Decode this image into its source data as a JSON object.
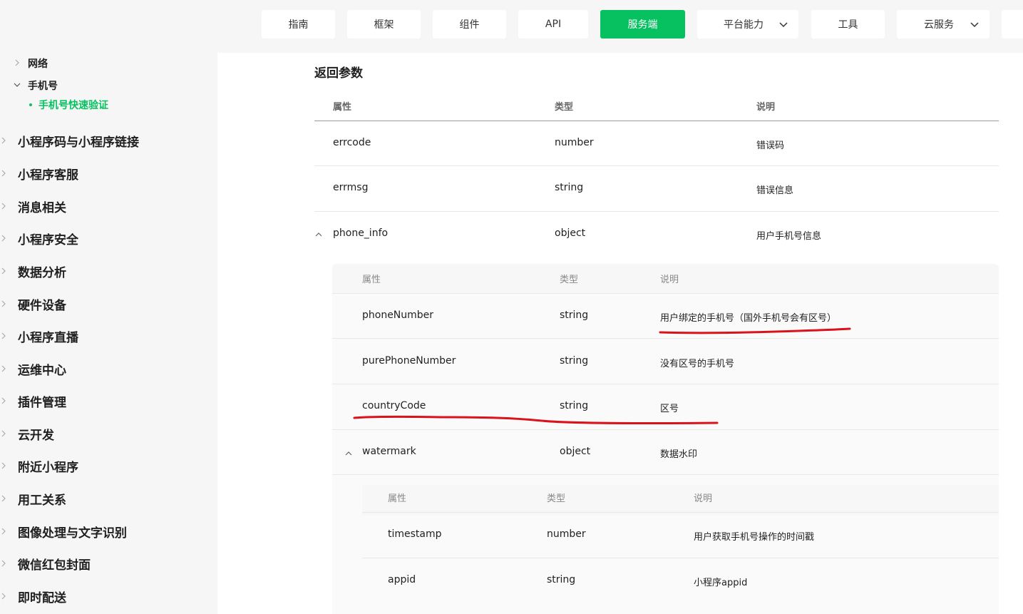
{
  "nav": {
    "tabs": [
      {
        "label": "指南"
      },
      {
        "label": "框架"
      },
      {
        "label": "组件"
      },
      {
        "label": "API"
      },
      {
        "label": "服务端"
      },
      {
        "label": "平台能力"
      },
      {
        "label": "工具"
      },
      {
        "label": "云服务"
      }
    ],
    "active_tab": "服务端",
    "accent_color": "#07c160"
  },
  "sidebar": {
    "sub_items": [
      {
        "label": "网络"
      },
      {
        "label": "手机号"
      }
    ],
    "active_leaf": "手机号快速验证",
    "items": [
      {
        "label": "小程序码与小程序链接"
      },
      {
        "label": "小程序客服"
      },
      {
        "label": "消息相关"
      },
      {
        "label": "小程序安全"
      },
      {
        "label": "数据分析"
      },
      {
        "label": "硬件设备"
      },
      {
        "label": "小程序直播"
      },
      {
        "label": "运维中心"
      },
      {
        "label": "插件管理"
      },
      {
        "label": "云开发"
      },
      {
        "label": "附近小程序"
      },
      {
        "label": "用工关系"
      },
      {
        "label": "图像处理与文字识别"
      },
      {
        "label": "微信红包封面"
      },
      {
        "label": "即时配送"
      }
    ]
  },
  "main": {
    "section_title": "返回参数",
    "headers": {
      "attr": "属性",
      "type": "类型",
      "desc": "说明"
    },
    "rows": [
      {
        "name": "errcode",
        "type": "number",
        "desc": "错误码"
      },
      {
        "name": "errmsg",
        "type": "string",
        "desc": "错误信息"
      },
      {
        "name": "phone_info",
        "type": "object",
        "desc": "用户手机号信息"
      }
    ],
    "phone_info_rows": [
      {
        "name": "phoneNumber",
        "type": "string",
        "desc": "用户绑定的手机号（国外手机号会有区号）"
      },
      {
        "name": "purePhoneNumber",
        "type": "string",
        "desc": "没有区号的手机号"
      },
      {
        "name": "countryCode",
        "type": "string",
        "desc": "区号"
      },
      {
        "name": "watermark",
        "type": "object",
        "desc": "数据水印"
      }
    ],
    "watermark_rows": [
      {
        "name": "timestamp",
        "type": "number",
        "desc": "用户获取手机号操作的时间戳"
      },
      {
        "name": "appid",
        "type": "string",
        "desc": "小程序appid"
      }
    ]
  },
  "annotation_color": "#d9121b"
}
